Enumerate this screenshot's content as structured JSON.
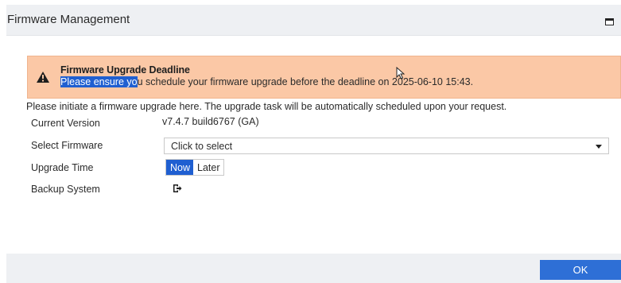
{
  "header": {
    "title": "Firmware Management",
    "icon": "maximize-icon"
  },
  "alert": {
    "title": "Firmware Upgrade Deadline",
    "message_selected": "Please ensure yo",
    "message_rest": "u schedule your firmware upgrade before the deadline on 2025-06-10 15:43.",
    "icon": "warning-icon",
    "background": "#fbc8a6"
  },
  "intro": "Please initiate a firmware upgrade here. The upgrade task will be automatically scheduled upon your request.",
  "form": {
    "current_version_label": "Current Version",
    "current_version_value": "v7.4.7 build6767 (GA)",
    "select_firmware_label": "Select Firmware",
    "select_firmware_value": "Click to select",
    "upgrade_time_label": "Upgrade Time",
    "upgrade_time_options": [
      "Now",
      "Later"
    ],
    "upgrade_time_selected": "Now",
    "backup_system_label": "Backup System",
    "backup_icon": "export-icon"
  },
  "footer": {
    "ok_label": "OK"
  },
  "colors": {
    "accent": "#1f5fd1",
    "button": "#2e6fd6",
    "header_bg": "#eef0f3"
  }
}
